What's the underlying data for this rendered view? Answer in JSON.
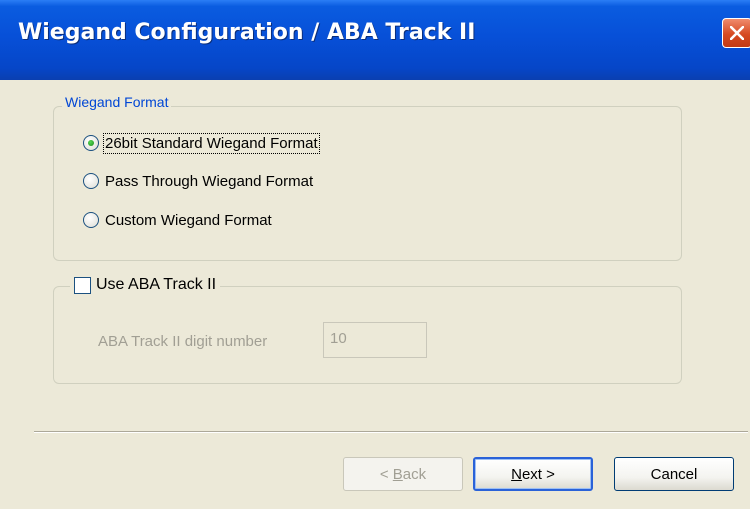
{
  "window": {
    "title": "Wiegand Configuration / ABA Track II",
    "close_label": "✕"
  },
  "wiegand_format": {
    "legend": "Wiegand Format",
    "options": [
      {
        "label": "26bit Standard Wiegand Format",
        "checked": true
      },
      {
        "label": "Pass Through Wiegand Format",
        "checked": false
      },
      {
        "label": "Custom Wiegand Format",
        "checked": false
      }
    ]
  },
  "aba_track": {
    "checkbox_label": "Use ABA Track II",
    "checked": false,
    "digit_label": "ABA Track II digit number",
    "digit_value": "10"
  },
  "buttons": {
    "back_prefix": "< ",
    "back_accel": "B",
    "back_suffix": "ack",
    "next_accel": "N",
    "next_suffix": "ext >",
    "cancel": "Cancel"
  },
  "colors": {
    "dialog_bg": "#ece9d8",
    "titlebar_blue": "#0750d8",
    "groupbox_legend_blue": "#0046d5",
    "disabled_text": "#a19f94",
    "radio_checked_green": "#1b8a1b"
  }
}
